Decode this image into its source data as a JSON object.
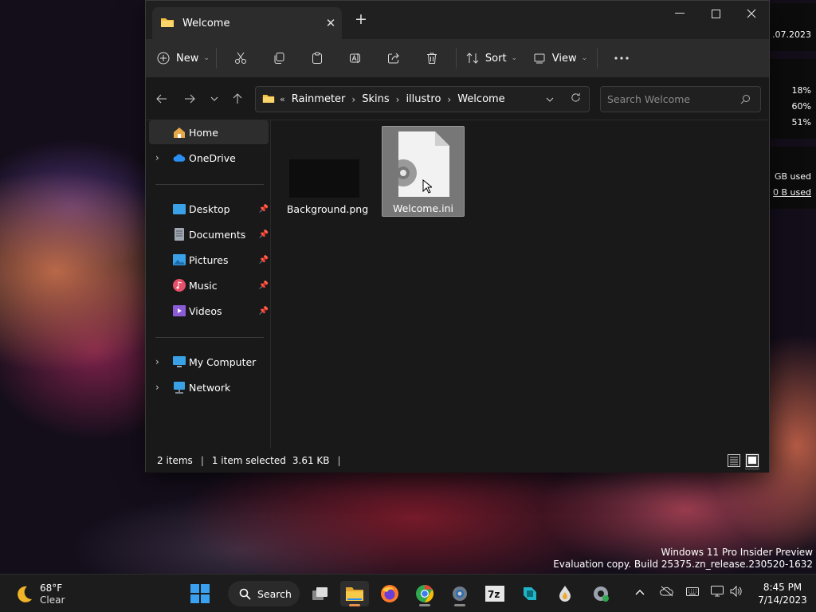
{
  "window": {
    "tab_title": "Welcome",
    "toolbar": {
      "new_label": "New",
      "sort_label": "Sort",
      "view_label": "View"
    },
    "breadcrumb": [
      "Rainmeter",
      "Skins",
      "illustro",
      "Welcome"
    ],
    "breadcrumb_overflow": "«",
    "search_placeholder": "Search Welcome",
    "sidebar": {
      "home": "Home",
      "onedrive": "OneDrive",
      "quick": [
        "Desktop",
        "Documents",
        "Pictures",
        "Music",
        "Videos"
      ],
      "my_computer": "My Computer",
      "network": "Network"
    },
    "files": [
      {
        "name": "Background.png",
        "selected": false,
        "icon": "image-thumbnail"
      },
      {
        "name": "Welcome.ini",
        "selected": true,
        "icon": "settings-file-icon"
      }
    ],
    "status": {
      "items": "2 items",
      "selected": "1 item selected",
      "size": "3.61 KB"
    }
  },
  "desktop_widget": {
    "date": ".07.2023",
    "cpu": [
      "18%",
      "60%",
      "51%"
    ],
    "disk": [
      "GB used",
      "0 B used"
    ]
  },
  "watermark": {
    "line1": "Windows 11 Pro Insider Preview",
    "line2": "Evaluation copy. Build 25375.zn_release.230520-1632"
  },
  "taskbar": {
    "weather_temp": "68°F",
    "weather_desc": "Clear",
    "search_label": "Search",
    "time": "8:45 PM",
    "date": "7/14/2023",
    "apps": [
      "start-icon",
      "task-view-icon",
      "file-explorer-icon",
      "firefox-icon",
      "chrome-icon",
      "settings-gear-icon",
      "7zip-icon",
      "app-icon",
      "droplet-icon",
      "settings-icon"
    ]
  },
  "colors": {
    "accent": "#0078d4",
    "folder": "#f3c041",
    "taskbar_active": "#e88f4f"
  }
}
